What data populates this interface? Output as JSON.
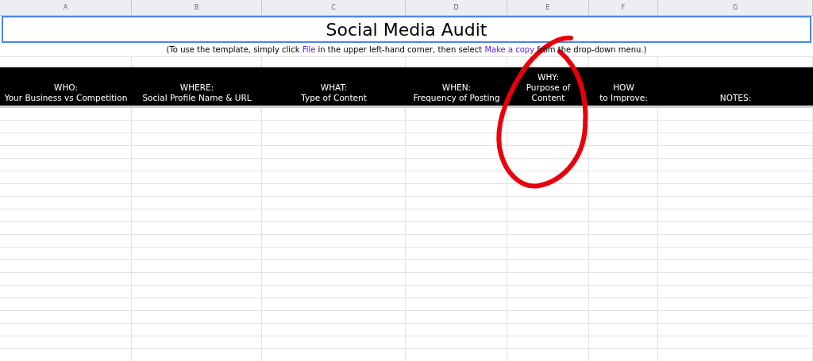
{
  "columns": [
    "A",
    "B",
    "C",
    "D",
    "E",
    "F",
    "G"
  ],
  "title": "Social Media Audit",
  "instructions": [
    {
      "kind": "text",
      "text": "(To use the template, simply click "
    },
    {
      "kind": "link",
      "text": "File"
    },
    {
      "kind": "text",
      "text": " in the upper left-hand corner, then select "
    },
    {
      "kind": "link",
      "text": "Make a copy"
    },
    {
      "kind": "text",
      "text": " from the drop-down menu.)"
    }
  ],
  "headers": [
    [
      "WHO:",
      "Your Business vs Competition"
    ],
    [
      "WHERE:",
      "Social Profile Name & URL"
    ],
    [
      "WHAT:",
      "Type of Content"
    ],
    [
      "WHEN:",
      "Frequency of Posting"
    ],
    [
      "WHY:",
      "Purpose of",
      "Content"
    ],
    [
      "HOW",
      "to Improve:"
    ],
    [
      "NOTES:"
    ]
  ]
}
